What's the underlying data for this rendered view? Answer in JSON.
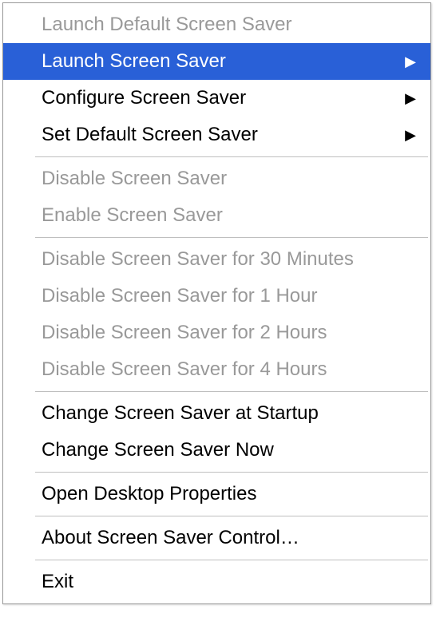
{
  "menu": {
    "items": [
      {
        "label": "Launch Default Screen Saver",
        "disabled": true,
        "submenu": false
      },
      {
        "label": "Launch Screen Saver",
        "disabled": false,
        "submenu": true,
        "selected": true
      },
      {
        "label": "Configure Screen Saver",
        "disabled": false,
        "submenu": true
      },
      {
        "label": "Set Default Screen Saver",
        "disabled": false,
        "submenu": true
      },
      {
        "separator": true
      },
      {
        "label": "Disable Screen Saver",
        "disabled": true,
        "submenu": false
      },
      {
        "label": "Enable Screen Saver",
        "disabled": true,
        "submenu": false
      },
      {
        "separator": true
      },
      {
        "label": "Disable Screen Saver for 30 Minutes",
        "disabled": true,
        "submenu": false
      },
      {
        "label": "Disable Screen Saver for 1 Hour",
        "disabled": true,
        "submenu": false
      },
      {
        "label": "Disable Screen Saver for 2 Hours",
        "disabled": true,
        "submenu": false
      },
      {
        "label": "Disable Screen Saver for 4 Hours",
        "disabled": true,
        "submenu": false
      },
      {
        "separator": true
      },
      {
        "label": "Change Screen Saver at Startup",
        "disabled": false,
        "submenu": false
      },
      {
        "label": "Change Screen Saver Now",
        "disabled": false,
        "submenu": false
      },
      {
        "separator": true
      },
      {
        "label": "Open Desktop Properties",
        "disabled": false,
        "submenu": false
      },
      {
        "separator": true
      },
      {
        "label": "About Screen Saver Control…",
        "disabled": false,
        "submenu": false
      },
      {
        "separator": true
      },
      {
        "label": "Exit",
        "disabled": false,
        "submenu": false
      }
    ]
  }
}
